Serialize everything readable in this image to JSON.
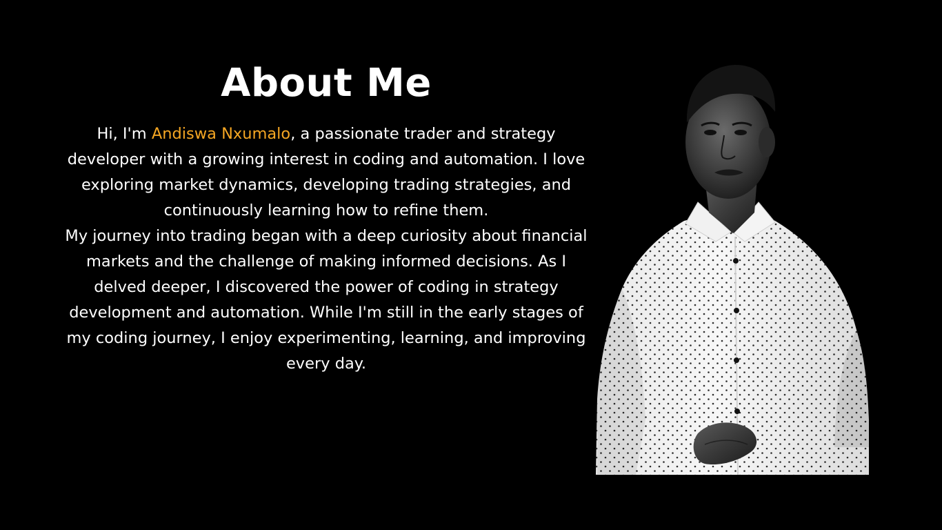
{
  "heading": {
    "title": "About Me"
  },
  "bio": {
    "intro_prefix": "Hi, I'm ",
    "name": "Andiswa Nxumalo",
    "intro_suffix": ", a passionate trader and strategy developer with a growing interest in coding and automation. I love exploring market dynamics, developing trading strategies, and continuously learning how to refine them.",
    "paragraph_2": "My journey into trading began with a deep curiosity about financial markets and the challenge of making informed decisions. As I delved deeper, I discovered the power of coding in strategy development and automation. While I'm still in the early stages of my coding journey, I enjoy experimenting, learning, and improving every day."
  },
  "colors": {
    "background": "#000000",
    "text": "#ffffff",
    "accent": "#f5a623"
  },
  "portrait": {
    "icon": "person-portrait-icon",
    "style": "black-and-white cutout photo of a man in a dotted white shirt"
  }
}
